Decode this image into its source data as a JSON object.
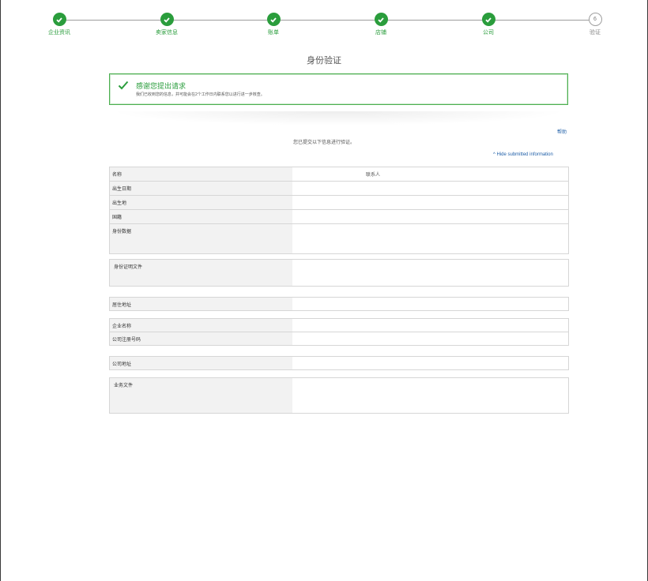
{
  "stepper": {
    "steps": [
      {
        "label": "企业资讯",
        "state": "done"
      },
      {
        "label": "卖家信息",
        "state": "done"
      },
      {
        "label": "账单",
        "state": "done"
      },
      {
        "label": "店铺",
        "state": "done"
      },
      {
        "label": "公司",
        "state": "done"
      },
      {
        "label": "验证",
        "state": "current",
        "number": "6"
      }
    ]
  },
  "page_title": "身份验证",
  "success": {
    "title": "感谢您提出请求",
    "message": "我们已收到您的信息，并可能会在2个工作日内联系您以进行进一步核查。"
  },
  "help_label": "帮助",
  "submitted_text": "您已提交以下信息进行验证。",
  "hide_link": "^ Hide submitted information",
  "sections": {
    "identity": {
      "name_label": "名称",
      "name_value": "联系人",
      "dob_label": "出生日期",
      "pob_label": "出生地",
      "nationality_label": "国籍",
      "id_data_label": "身份数据"
    },
    "id_doc_label": "身份证明文件",
    "residence_label": "居住地址",
    "company": {
      "name_label": "企业名称",
      "reg_label": "公司注册号码"
    },
    "company_address_label": "公司地址",
    "business_doc_label": "业务文件"
  },
  "colors": {
    "success_green": "#2a9d3c",
    "link_blue": "#1f5fa8",
    "key_bg": "#f2f2f2",
    "border": "#d6d6d6"
  }
}
